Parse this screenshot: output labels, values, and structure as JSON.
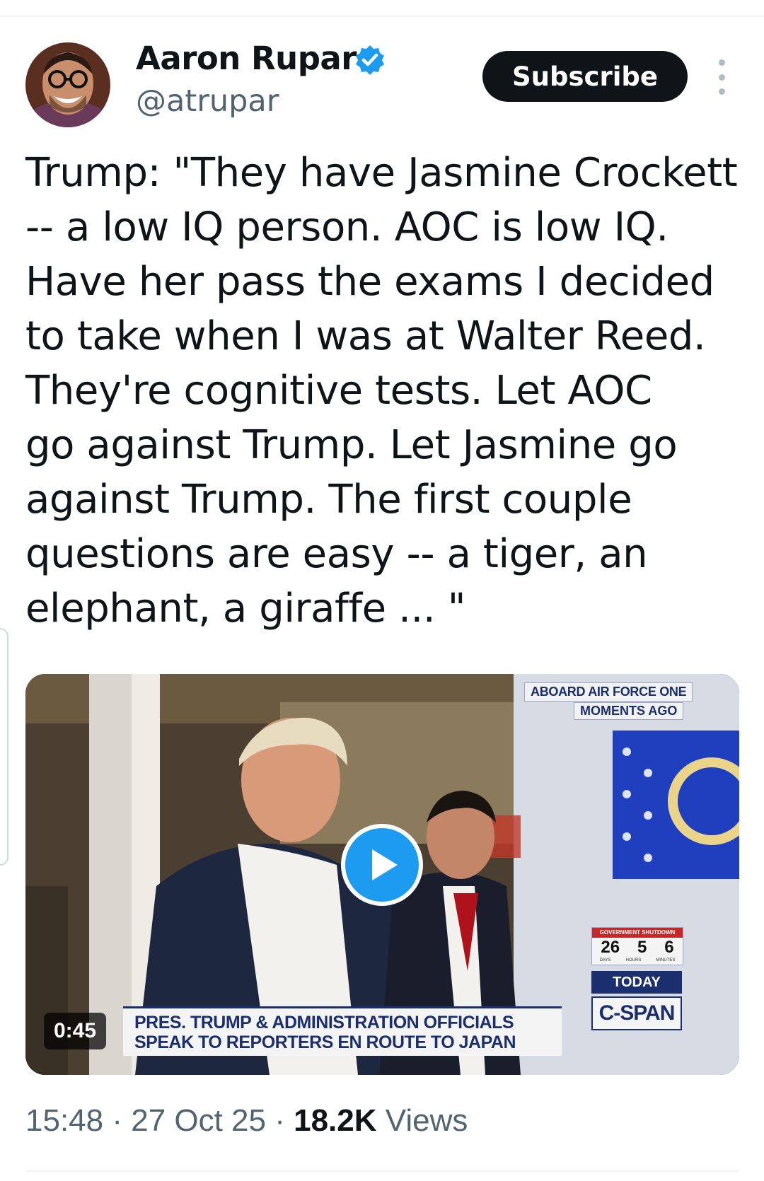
{
  "author": {
    "name": "Aaron Rupar",
    "handle": "@atrupar",
    "verified": true,
    "verified_color": "#1d9bf0"
  },
  "actions": {
    "subscribe_label": "Subscribe",
    "more_icon": "more-vertical-icon"
  },
  "tweet": {
    "text": "Trump: \"They have Jasmine Crockett\n-- a low IQ person. AOC is low IQ.\nHave her pass the exams I decided\nto take when I was at Walter Reed.\nThey're cognitive tests. Let AOC\ngo against Trump. Let Jasmine go\nagainst Trump. The first couple\nquestions are easy -- a tiger, an\nelephant, a giraffe ... \""
  },
  "video": {
    "duration": "0:45",
    "play_icon": "play-icon",
    "overlay": {
      "bug_line1": "ABOARD AIR FORCE ONE",
      "bug_line2": "MOMENTS AGO",
      "lower_third_line1": "PRES. TRUMP & ADMINISTRATION OFFICIALS",
      "lower_third_line2": "SPEAK TO REPORTERS EN ROUTE TO JAPAN",
      "shutdown_label": "GOVERNMENT SHUTDOWN",
      "shutdown_days": "26",
      "shutdown_hours": "5",
      "shutdown_minutes": "6",
      "unit_days": "DAYS",
      "unit_hours": "HOURS",
      "unit_minutes": "MINUTES",
      "today": "TODAY",
      "network": "C-SPAN"
    }
  },
  "meta": {
    "time": "15:48",
    "separator": " · ",
    "date": "27 Oct 25",
    "views_count": "18.2K",
    "views_label": "Views"
  },
  "colors": {
    "text_primary": "#0f1419",
    "text_secondary": "#536471",
    "accent": "#1d9bf0"
  }
}
